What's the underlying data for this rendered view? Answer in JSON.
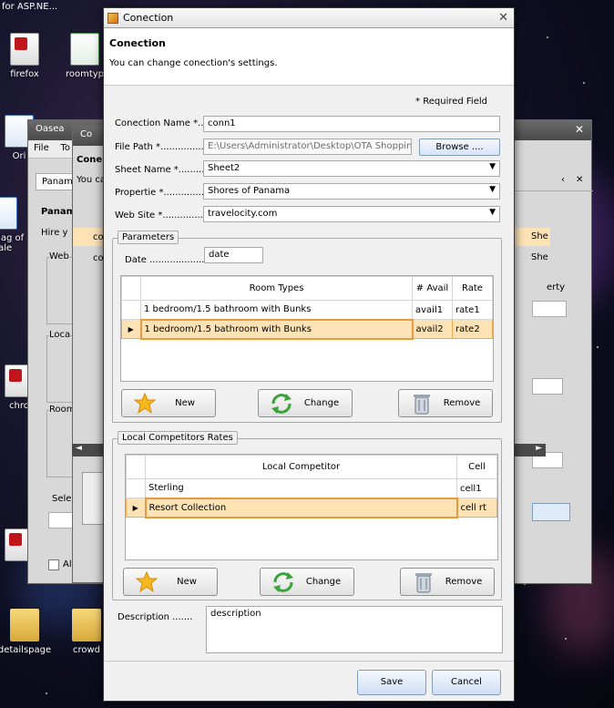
{
  "desktop": {
    "top_text": "for ASP.NE...",
    "icons": [
      {
        "label": "firefox"
      },
      {
        "label": "roomtyp"
      },
      {
        "label": "Ori"
      },
      {
        "label": "Manag of sale"
      },
      {
        "label": "chro"
      },
      {
        "label": "detailspage"
      },
      {
        "label": "crowd"
      }
    ]
  },
  "bg_windows": {
    "win1_title": "Oasea",
    "win1_menu": [
      "File",
      "To"
    ],
    "win2_title": "Co",
    "frag": {
      "panam": "Panam",
      "panam2": "Panam",
      "hire": "Hire y",
      "web": "Web",
      "loca": "Loca",
      "room": "Room",
      "sele": "Sele",
      "al": "Al",
      "cone": "Cone",
      "you": "You ca",
      "co1": "co",
      "co2": "co",
      "she1": "She",
      "she2": "She",
      "erty": "erty"
    }
  },
  "dialog": {
    "window_title": "Conection",
    "header_title": "Conection",
    "header_subtitle": "You can change conection's settings.",
    "required_note": "* Required Field",
    "fields": {
      "conection_name_label": "Conection Name *....",
      "conection_name_value": "conn1",
      "file_path_label": "File Path *...................",
      "file_path_value": "E:\\Users\\Administrator\\Desktop\\OTA Shopping T",
      "browse_label": "Browse ....",
      "sheet_name_label": "Sheet Name *...............",
      "sheet_name_value": "Sheet2",
      "propertie_label": "Propertie *..................",
      "propertie_value": "Shores of Panama",
      "website_label": "Web Site *...................",
      "website_value": "travelocity.com"
    },
    "parameters": {
      "group_title": "Parameters",
      "date_label": "Date ....................",
      "date_value": "date",
      "columns": [
        "Room Types",
        "# Avail",
        "Rate"
      ],
      "rows": [
        {
          "room_type": "1 bedroom/1.5 bathroom with Bunks",
          "avail": "avail1",
          "rate": "rate1"
        },
        {
          "room_type": "1 bedroom/1.5 bathroom with Bunks",
          "avail": "avail2",
          "rate": "rate2"
        }
      ],
      "new_label": "New",
      "change_label": "Change",
      "remove_label": "Remove"
    },
    "competitors": {
      "group_title": "Local Competitors Rates",
      "columns": [
        "Local Competitor",
        "Cell"
      ],
      "rows": [
        {
          "competitor": "Sterling",
          "cell": "cell1"
        },
        {
          "competitor": "Resort Collection",
          "cell": "cell rt"
        }
      ],
      "new_label": "New",
      "change_label": "Change",
      "remove_label": "Remove"
    },
    "description_label": "Description .......",
    "description_value": "description",
    "save_label": "Save",
    "cancel_label": "Cancel"
  },
  "colors": {
    "selected_row": "#fde2b6",
    "selected_border": "#e89a40",
    "button_border": "#7f9db9"
  }
}
